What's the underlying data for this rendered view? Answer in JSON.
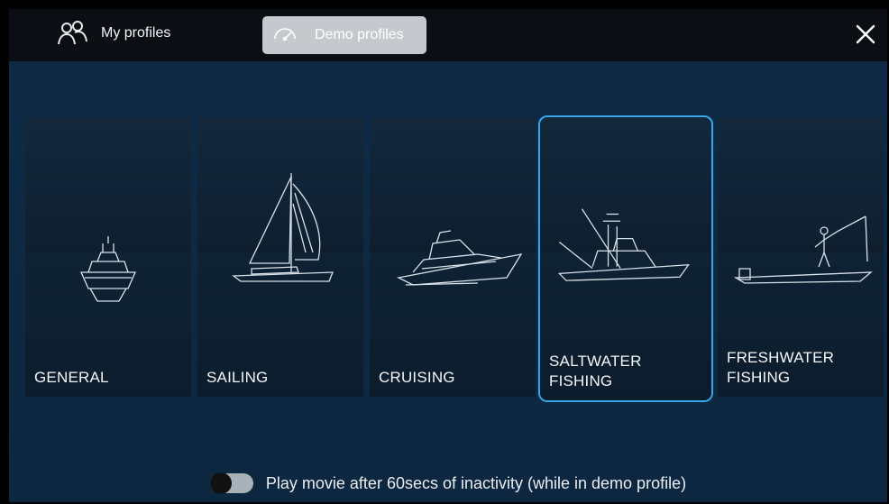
{
  "header": {
    "tabs": [
      {
        "label": "My profiles",
        "icon": "users-icon",
        "selected": false
      },
      {
        "label": "Demo profiles",
        "icon": "demo-dial-icon",
        "selected": true
      }
    ],
    "close_icon": "close-icon"
  },
  "profiles": [
    {
      "label": "GENERAL",
      "icon": "motor-yacht-icon",
      "selected": false
    },
    {
      "label": "SAILING",
      "icon": "sailboat-icon",
      "selected": false
    },
    {
      "label": "CRUISING",
      "icon": "cruiser-icon",
      "selected": false
    },
    {
      "label": "SALTWATER\nFISHING",
      "icon": "sportfisher-icon",
      "selected": true
    },
    {
      "label": "FRESHWATER\nFISHING",
      "icon": "bass-boat-icon",
      "selected": false
    }
  ],
  "footer": {
    "toggle_on": false,
    "text": "Play movie after 60secs of inactivity (while in demo profile)"
  },
  "colors": {
    "accent": "#35a6e8",
    "background": "#0f2a44",
    "selected_tab": "#c5c9cd"
  }
}
